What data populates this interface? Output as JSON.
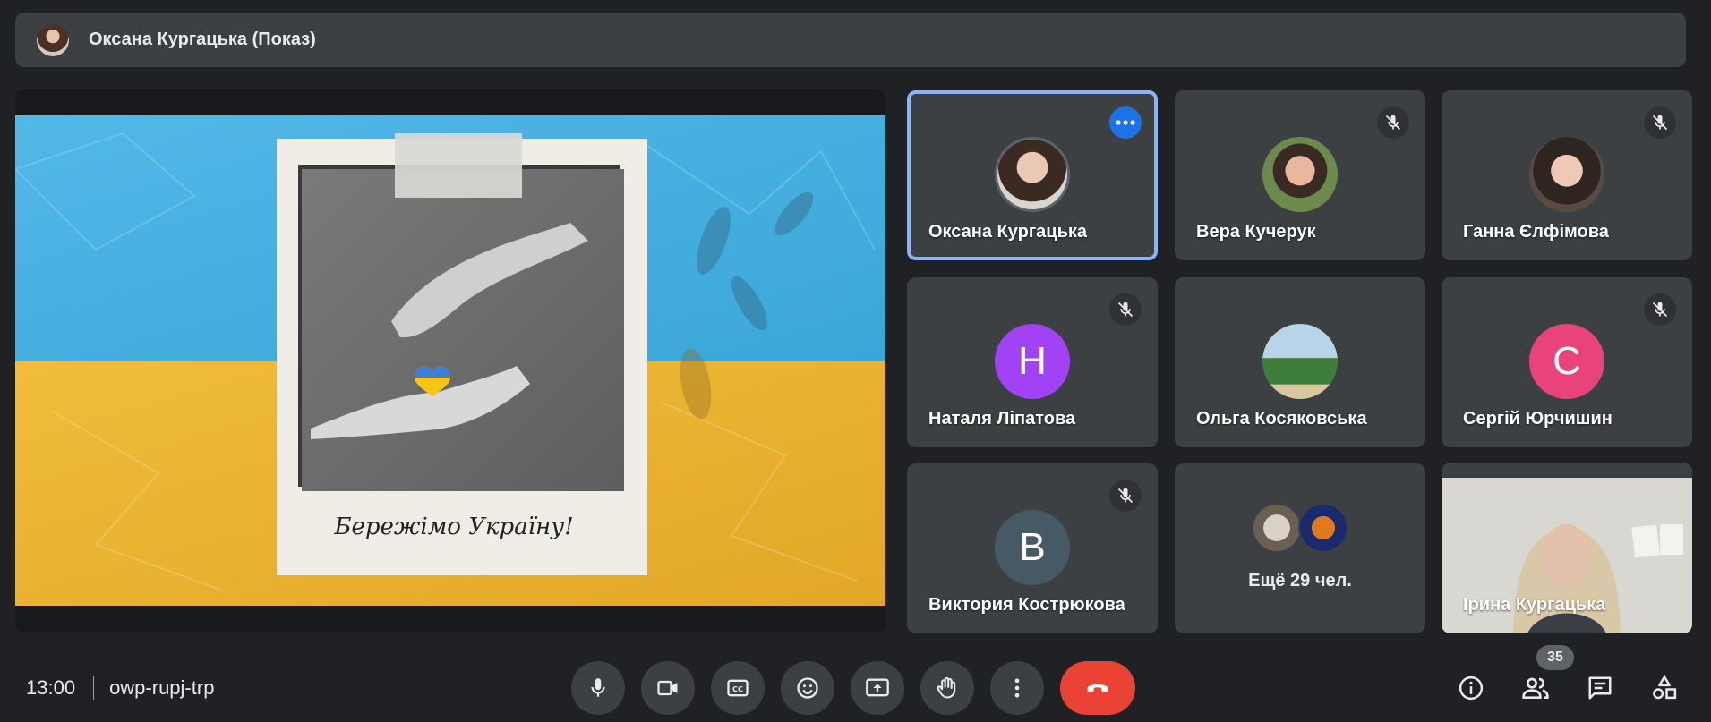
{
  "presenter_bar": {
    "name": "Оксана Кургацька (Показ)"
  },
  "slide": {
    "caption": "Бережімо Україну!"
  },
  "participants": [
    {
      "name": "Оксана Кургацька",
      "avatar": "photo",
      "state": "speaking-menu"
    },
    {
      "name": "Вера Кучерук",
      "avatar": "photo",
      "state": "muted"
    },
    {
      "name": "Ганна Єлфімова",
      "avatar": "photo",
      "state": "muted"
    },
    {
      "name": "Наталя Ліпатова",
      "avatar_letter": "Н",
      "avatar_color": "#a142f4",
      "state": "muted"
    },
    {
      "name": "Ольга Косяковська",
      "avatar": "photo",
      "state": "unmuted"
    },
    {
      "name": "Сергій Юрчишин",
      "avatar_letter": "С",
      "avatar_color": "#e8437a",
      "state": "muted"
    },
    {
      "name": "Виктория Кострюкова",
      "avatar_letter": "В",
      "avatar_color": "#455a64",
      "state": "muted"
    },
    {
      "name": "Ірина Кургацька",
      "avatar": "video",
      "state": "unmuted"
    }
  ],
  "more_tile": {
    "label": "Ещё 29 чел."
  },
  "bottom_bar": {
    "time": "13:00",
    "meeting_code": "owp-rupj-trp",
    "participant_count": "35",
    "controls": [
      {
        "icon": "mic-icon"
      },
      {
        "icon": "camera-icon"
      },
      {
        "icon": "captions-icon"
      },
      {
        "icon": "emoji-icon"
      },
      {
        "icon": "present-screen-icon"
      },
      {
        "icon": "raise-hand-icon"
      },
      {
        "icon": "more-options-icon"
      },
      {
        "icon": "end-call-icon"
      }
    ],
    "right_icons": [
      {
        "icon": "info-icon"
      },
      {
        "icon": "people-icon"
      },
      {
        "icon": "chat-icon"
      },
      {
        "icon": "activities-icon"
      }
    ]
  },
  "colors": {
    "background": "#202124",
    "tile": "#3c4043",
    "active_border": "#8ab4f8",
    "end_call": "#ea4335",
    "menu_button": "#1a73e8"
  }
}
